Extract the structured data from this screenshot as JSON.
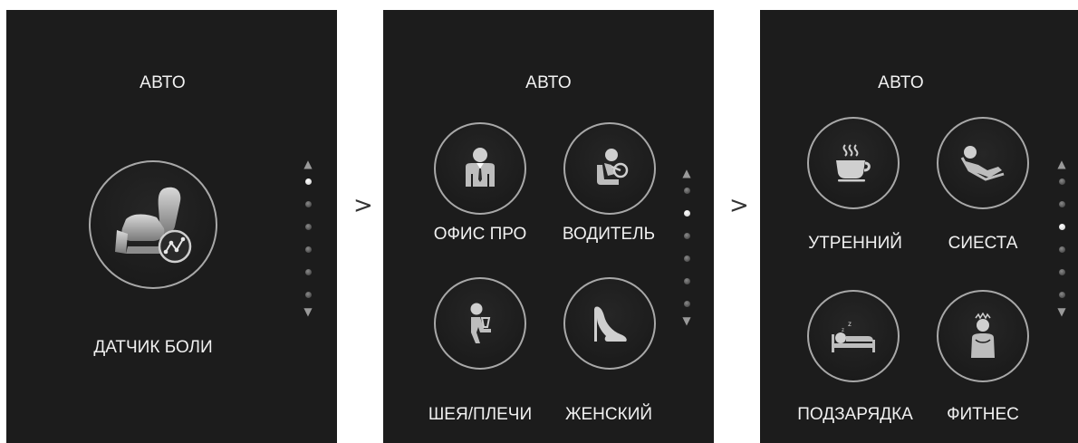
{
  "separator": ">",
  "screens": [
    {
      "title": "АВТО",
      "items": [
        {
          "label": "ДАТЧИК БОЛИ",
          "icon": "massage-chair-sensor-icon"
        }
      ],
      "scroll": {
        "dots": 6,
        "active_index": 0
      }
    },
    {
      "title": "АВТО",
      "items": [
        {
          "label": "ОФИС ПРО",
          "icon": "office-person-icon"
        },
        {
          "label": "ВОДИТЕЛЬ",
          "icon": "driver-icon"
        },
        {
          "label": "ШЕЯ/ПЛЕЧИ",
          "icon": "neck-shoulders-icon"
        },
        {
          "label": "ЖЕНСКИЙ",
          "icon": "high-heel-icon"
        }
      ],
      "scroll": {
        "dots": 6,
        "active_index": 1
      }
    },
    {
      "title": "АВТО",
      "items": [
        {
          "label": "УТРЕННИЙ",
          "icon": "coffee-cup-icon"
        },
        {
          "label": "СИЕСТА",
          "icon": "reclining-person-icon"
        },
        {
          "label": "ПОДЗАРЯДКА",
          "icon": "sleeping-person-icon"
        },
        {
          "label": "ФИТНЕС",
          "icon": "fitness-person-icon"
        }
      ],
      "scroll": {
        "dots": 6,
        "active_index": 2
      }
    }
  ],
  "colors": {
    "panel_bg": "#1c1c1c",
    "circle_border": "#a8a8a8",
    "text": "#f0f0f0",
    "active_dot": "#ffffff"
  }
}
